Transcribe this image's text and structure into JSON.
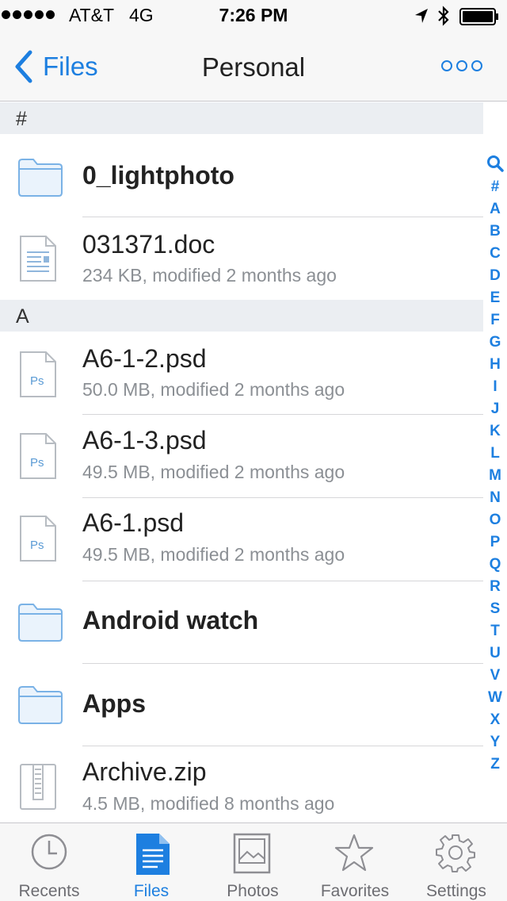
{
  "status_bar": {
    "carrier": "AT&T",
    "network": "4G",
    "time": "7:26 PM"
  },
  "nav": {
    "back_label": "Files",
    "title": "Personal"
  },
  "sections": [
    {
      "header": "#"
    },
    {
      "header": "A"
    }
  ],
  "files": [
    {
      "name": "0_lightphoto",
      "meta": "",
      "type": "folder-icon"
    },
    {
      "name": "031371.doc",
      "meta": "234 KB, modified 2 months ago",
      "type": "document-icon"
    },
    {
      "name": "A6-1-2.psd",
      "meta": "50.0 MB, modified 2 months ago",
      "type": "psd-file-icon",
      "icon_text": "Ps"
    },
    {
      "name": "A6-1-3.psd",
      "meta": "49.5 MB, modified 2 months ago",
      "type": "psd-file-icon",
      "icon_text": "Ps"
    },
    {
      "name": "A6-1.psd",
      "meta": "49.5 MB, modified 2 months ago",
      "type": "psd-file-icon",
      "icon_text": "Ps"
    },
    {
      "name": "Android watch",
      "meta": "",
      "type": "folder-icon"
    },
    {
      "name": "Apps",
      "meta": "",
      "type": "folder-icon"
    },
    {
      "name": "Archive.zip",
      "meta": "4.5 MB, modified 8 months ago",
      "type": "zip-file-icon"
    }
  ],
  "index": [
    "#",
    "A",
    "B",
    "C",
    "D",
    "E",
    "F",
    "G",
    "H",
    "I",
    "J",
    "K",
    "L",
    "M",
    "N",
    "O",
    "P",
    "Q",
    "R",
    "S",
    "T",
    "U",
    "V",
    "W",
    "X",
    "Y",
    "Z"
  ],
  "tabs": [
    {
      "label": "Recents",
      "icon": "clock-icon",
      "active": false
    },
    {
      "label": "Files",
      "icon": "files-icon",
      "active": true
    },
    {
      "label": "Photos",
      "icon": "photos-icon",
      "active": false
    },
    {
      "label": "Favorites",
      "icon": "star-icon",
      "active": false
    },
    {
      "label": "Settings",
      "icon": "gear-icon",
      "active": false
    }
  ],
  "colors": {
    "accent": "#1d7fe0",
    "folder": "#a9cdf0"
  }
}
